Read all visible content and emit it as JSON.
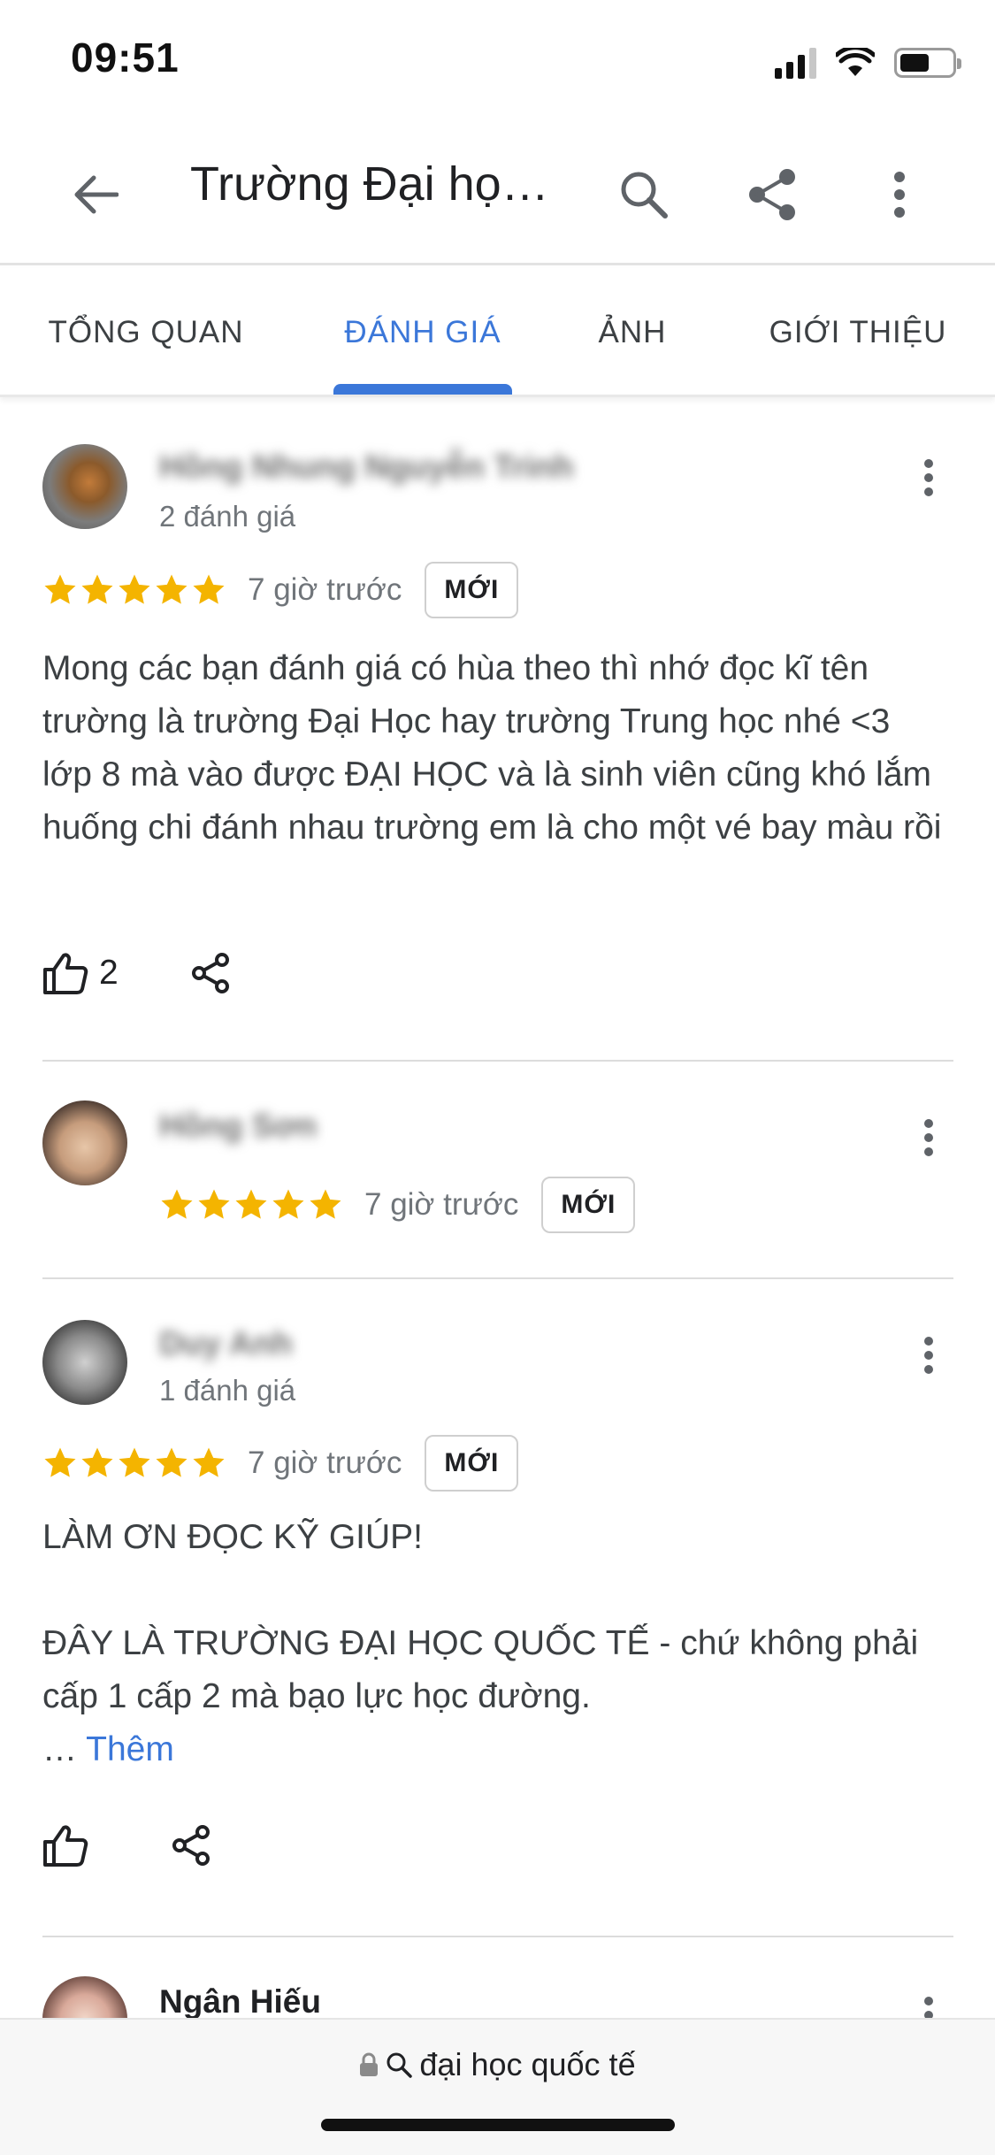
{
  "status_bar": {
    "time": "09:51"
  },
  "app_bar": {
    "title": "Trường Đại họ…"
  },
  "tabs": [
    {
      "label": "TỔNG QUAN",
      "active": false
    },
    {
      "label": "ĐÁNH GIÁ",
      "active": true
    },
    {
      "label": "ẢNH",
      "active": false
    },
    {
      "label": "GIỚI THIỆU",
      "active": false
    }
  ],
  "reviews": [
    {
      "name": "Hồng Nhung Nguyễn Trinh",
      "review_count": "2 đánh giá",
      "rating": 5,
      "time": "7 giờ trước",
      "badge": "MỚI",
      "text": "Mong các bạn đánh giá có hùa theo thì nhớ đọc kĩ tên trường là trường Đại Học hay trường Trung học nhé <3 lớp 8 mà vào được ĐẠI HỌC và là sinh viên cũng khó lắm huống chi đánh nhau trường em là cho một vé bay màu rồi",
      "likes": "2"
    },
    {
      "name": "Hồng Sơn",
      "rating": 5,
      "time": "7 giờ trước",
      "badge": "MỚI"
    },
    {
      "name": "Duy Anh",
      "review_count": "1 đánh giá",
      "rating": 5,
      "time": "7 giờ trước",
      "badge": "MỚI",
      "text_line1": "LÀM ƠN ĐỌC KỸ GIÚP!",
      "text_line2": "ĐÂY LÀ TRƯỜNG ĐẠI HỌC QUỐC TẾ - chứ không phải cấp 1 cấp 2 mà bạo lực học đường.",
      "ellipsis": "…",
      "more_label": "Thêm"
    },
    {
      "name": "Ngân Hiếu"
    }
  ],
  "url_bar": {
    "text": "đại học quốc tế"
  },
  "colors": {
    "accent": "#3b77d9",
    "star": "#f4b400"
  }
}
